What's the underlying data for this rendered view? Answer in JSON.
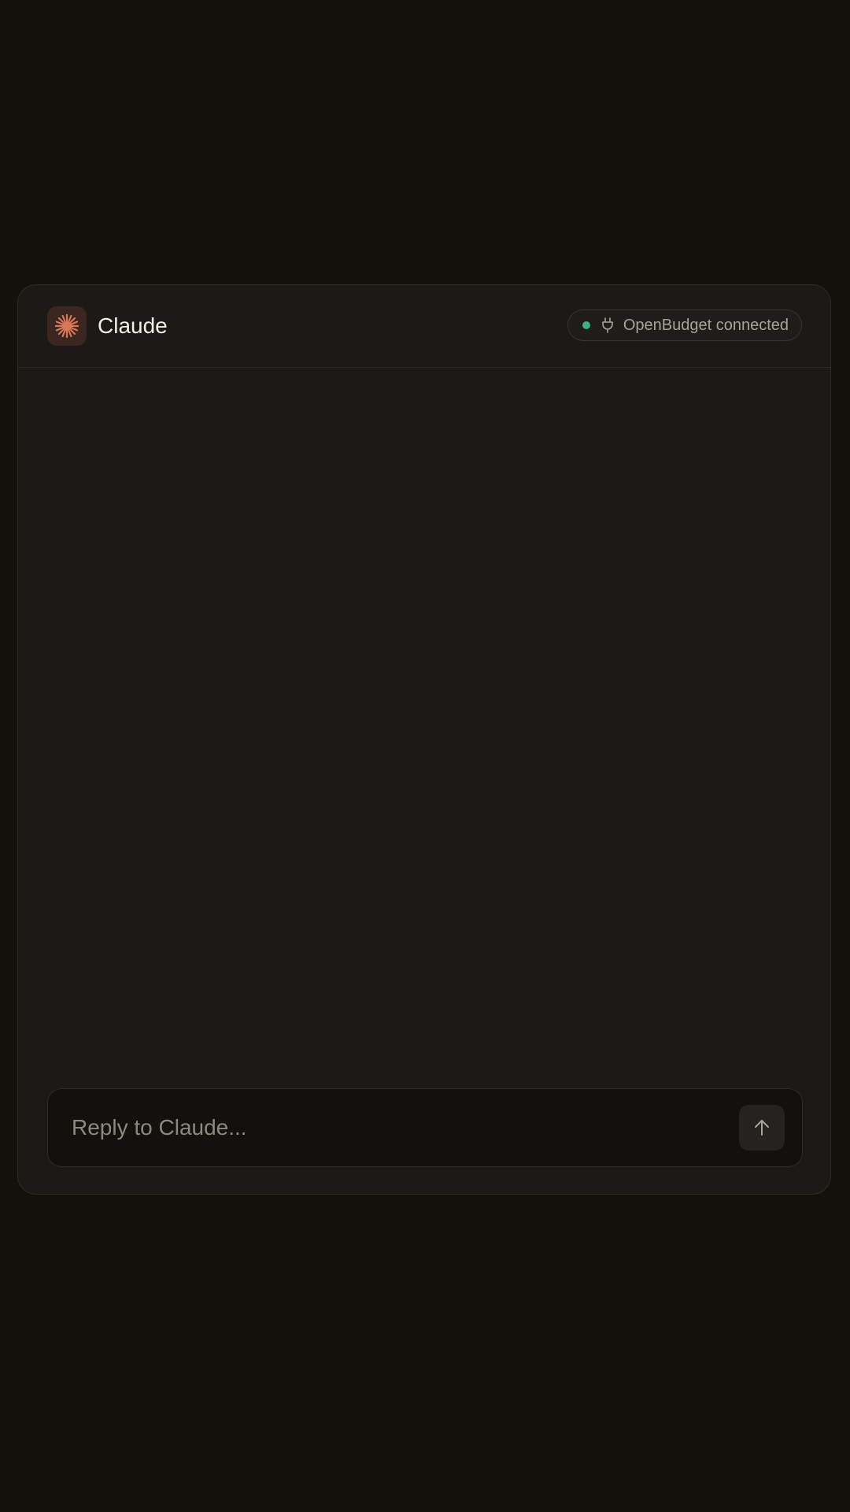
{
  "app": {
    "title": "Claude",
    "icon": "claude-sparkle-icon",
    "accent_color": "#d97757"
  },
  "connection": {
    "label": "OpenBudget connected",
    "status": "connected",
    "status_color": "#3fb07f",
    "icon": "plug-icon"
  },
  "composer": {
    "placeholder": "Reply to Claude...",
    "value": "",
    "send_icon": "arrow-up-icon"
  }
}
